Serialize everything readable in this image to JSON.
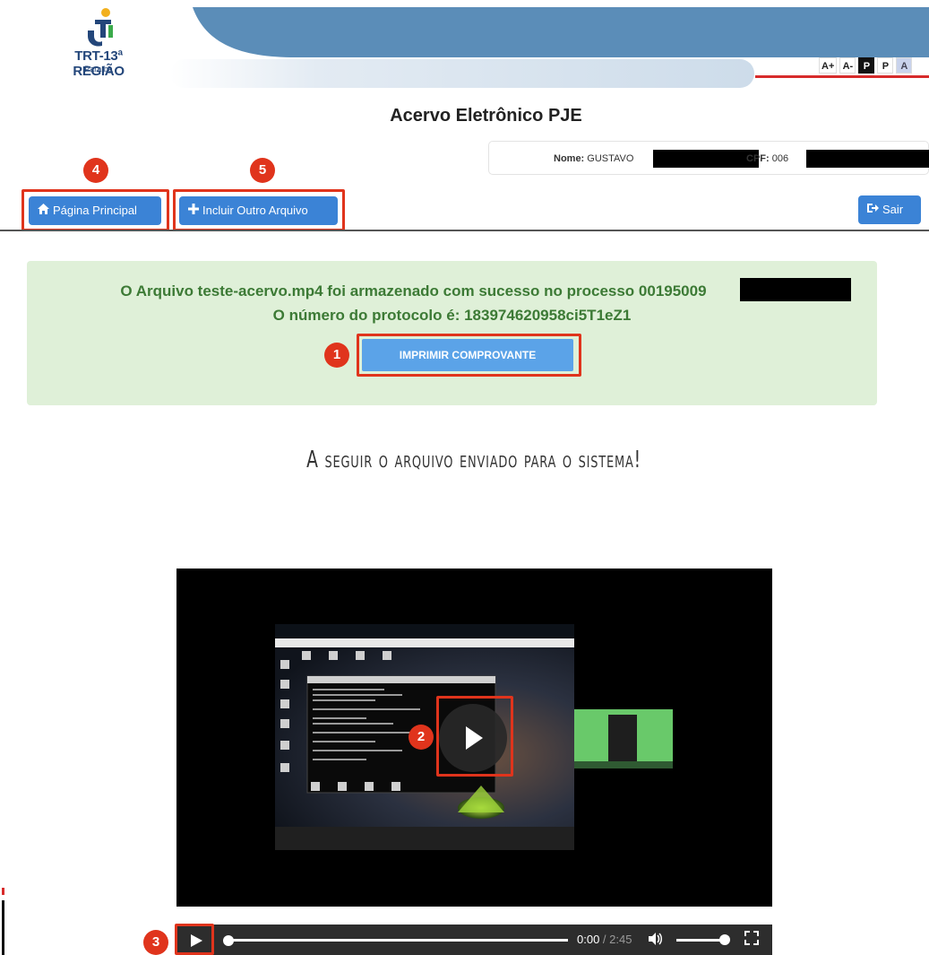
{
  "header": {
    "logo_text": "TRT-13ª REGIÃO",
    "logo_sub": "Paraíba",
    "font_tools": [
      "A+",
      "A-",
      "P",
      "P",
      "A"
    ]
  },
  "page": {
    "title": "Acervo Eletrônico PJE",
    "user": {
      "nome_label": "Nome:",
      "nome_value": "GUSTAVO",
      "cpf_label": "CPF:",
      "cpf_value": "006"
    }
  },
  "toolbar": {
    "home_label": "Página Principal",
    "add_label": "Incluir Outro Arquivo",
    "exit_label": "Sair"
  },
  "success": {
    "line1": "O Arquivo teste-acervo.mp4 foi armazenado com sucesso no processo 00195009",
    "line2": "O número do protocolo é: 183974620958ci5T1eZ1",
    "print_label": "IMPRIMIR COMPROVANTE"
  },
  "content": {
    "subtitle": "A seguir o arquivo enviado para o sistema!"
  },
  "video": {
    "current_time": "0:00",
    "separator": " / ",
    "duration": "2:45",
    "progress": 0,
    "volume": 1
  },
  "markers": {
    "m1": "1",
    "m2": "2",
    "m3": "3",
    "m4": "4",
    "m5": "5"
  },
  "colors": {
    "primary_button": "#3b83d6",
    "success_bg": "#dff0d8",
    "success_text": "#3c7a35",
    "annotation": "#e0341c"
  },
  "icons": [
    "home-icon",
    "plus-icon",
    "sign-out-icon",
    "play-icon",
    "volume-icon",
    "fullscreen-icon"
  ]
}
